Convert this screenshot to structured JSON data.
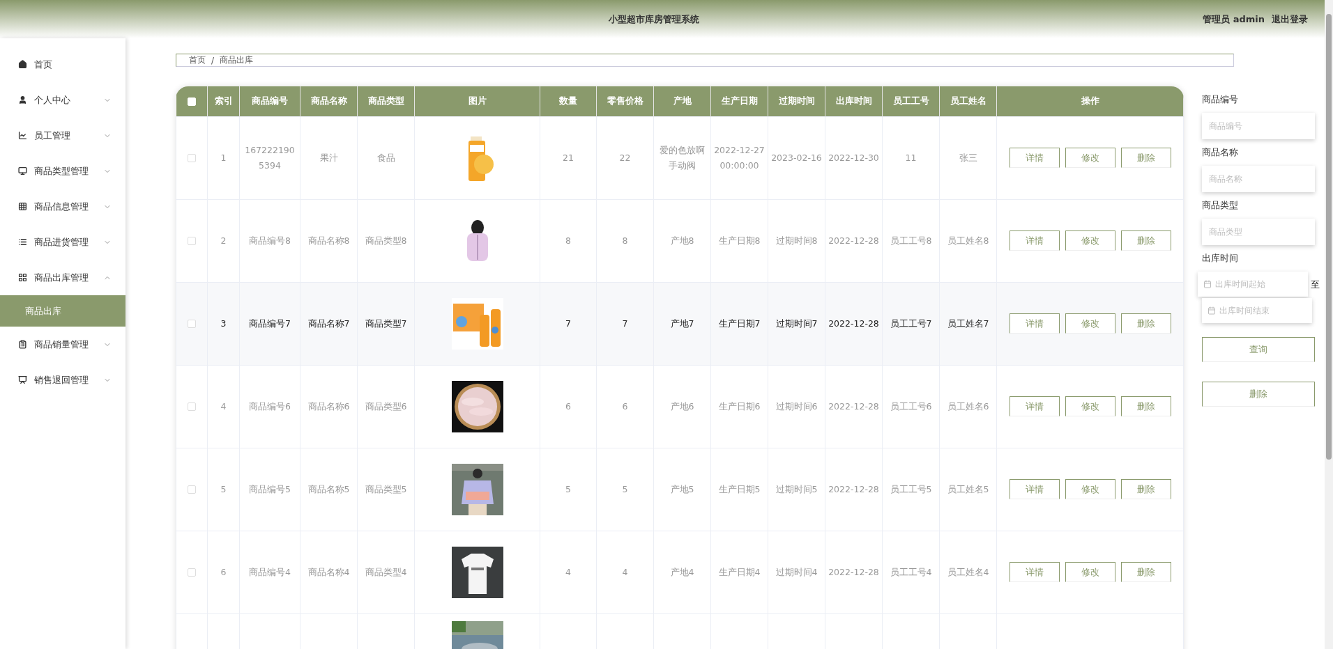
{
  "header": {
    "title": "小型超市库房管理系统",
    "user": "管理员 admin",
    "logout": "退出登录"
  },
  "sidebar": {
    "items": [
      {
        "kind": "link",
        "label": "首页"
      },
      {
        "kind": "menu",
        "label": "个人中心",
        "expanded": false
      },
      {
        "kind": "menu",
        "label": "员工管理",
        "expanded": false
      },
      {
        "kind": "menu",
        "label": "商品类型管理",
        "expanded": false
      },
      {
        "kind": "menu",
        "label": "商品信息管理",
        "expanded": false
      },
      {
        "kind": "menu",
        "label": "商品进货管理",
        "expanded": false
      },
      {
        "kind": "menu",
        "label": "商品出库管理",
        "expanded": true,
        "children": [
          {
            "label": "商品出库",
            "selected": true
          }
        ]
      },
      {
        "kind": "menu",
        "label": "商品销量管理",
        "expanded": false
      },
      {
        "kind": "menu",
        "label": "销售退回管理",
        "expanded": false
      }
    ]
  },
  "breadcrumb": [
    "首页",
    "/",
    "商品出库"
  ],
  "table": {
    "select_all_checked": false,
    "columns": [
      "索引",
      "商品编号",
      "商品名称",
      "商品类型",
      "图片",
      "数量",
      "零售价格",
      "产地",
      "生产日期",
      "过期时间",
      "出库时间",
      "员工工号",
      "员工姓名",
      "操作"
    ],
    "rows": [
      {
        "checked": false,
        "hovered": false,
        "cells": [
          "1",
          "1672221905394",
          "果汁",
          "食品",
          "",
          "21",
          "22",
          "爱的色放啊手动阀",
          "2022-12-27 00:00:00",
          "2023-02-16",
          "2022-12-30",
          "11",
          "张三"
        ],
        "actions": [
          "详情",
          "修改",
          "删除"
        ]
      },
      {
        "checked": false,
        "hovered": false,
        "cells": [
          "2",
          "商品编号8",
          "商品名称8",
          "商品类型8",
          "",
          "8",
          "8",
          "产地8",
          "生产日期8",
          "过期时间8",
          "2022-12-28",
          "员工工号8",
          "员工姓名8"
        ],
        "actions": [
          "详情",
          "修改",
          "删除"
        ]
      },
      {
        "checked": false,
        "hovered": true,
        "cells": [
          "3",
          "商品编号7",
          "商品名称7",
          "商品类型7",
          "",
          "7",
          "7",
          "产地7",
          "生产日期7",
          "过期时间7",
          "2022-12-28",
          "员工工号7",
          "员工姓名7"
        ],
        "actions": [
          "详情",
          "修改",
          "删除"
        ]
      },
      {
        "checked": false,
        "hovered": false,
        "cells": [
          "4",
          "商品编号6",
          "商品名称6",
          "商品类型6",
          "",
          "6",
          "6",
          "产地6",
          "生产日期6",
          "过期时间6",
          "2022-12-28",
          "员工工号6",
          "员工姓名6"
        ],
        "actions": [
          "详情",
          "修改",
          "删除"
        ]
      },
      {
        "checked": false,
        "hovered": false,
        "cells": [
          "5",
          "商品编号5",
          "商品名称5",
          "商品类型5",
          "",
          "5",
          "5",
          "产地5",
          "生产日期5",
          "过期时间5",
          "2022-12-28",
          "员工工号5",
          "员工姓名5"
        ],
        "actions": [
          "详情",
          "修改",
          "删除"
        ]
      },
      {
        "checked": false,
        "hovered": false,
        "cells": [
          "6",
          "商品编号4",
          "商品名称4",
          "商品类型4",
          "",
          "4",
          "4",
          "产地4",
          "生产日期4",
          "过期时间4",
          "2022-12-28",
          "员工工号4",
          "员工姓名4"
        ],
        "actions": [
          "详情",
          "修改",
          "删除"
        ]
      },
      {
        "kind": "partial"
      }
    ]
  },
  "search": {
    "fields": [
      {
        "kind": "text",
        "label": "商品编号",
        "placeholder": "商品编号"
      },
      {
        "kind": "text",
        "label": "商品名称",
        "placeholder": "商品名称"
      },
      {
        "kind": "text",
        "label": "商品类型",
        "placeholder": "商品类型"
      },
      {
        "kind": "daterange",
        "label": "出库时间",
        "start_placeholder": "出库时间起始",
        "separator": "至",
        "end_placeholder": "出库时间结束"
      }
    ],
    "buttons": [
      "查询",
      "删除"
    ]
  }
}
